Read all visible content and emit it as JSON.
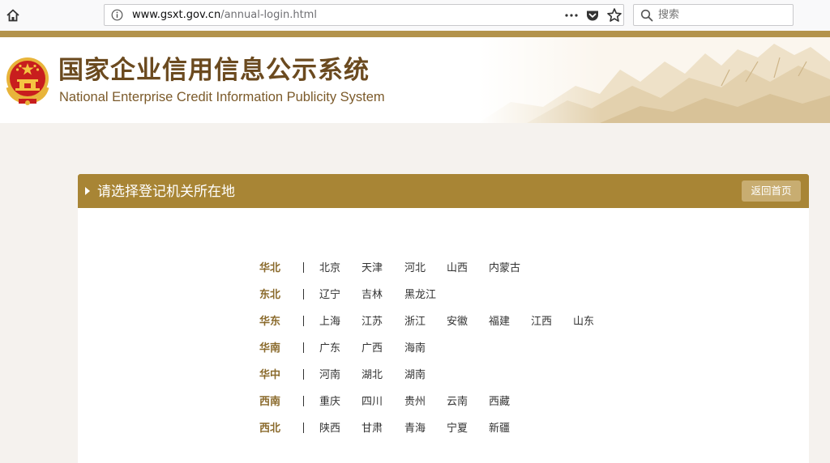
{
  "browser": {
    "url_domain": "www.gsxt.gov.cn",
    "url_path": "/annual-login.html",
    "search_placeholder": "搜索",
    "icons": [
      "home-icon",
      "info-icon",
      "more-icon",
      "pocket-icon",
      "star-icon",
      "search-icon"
    ]
  },
  "header": {
    "title_cn": "国家企业信用信息公示系统",
    "title_en": "National Enterprise Credit Information Publicity System",
    "colors": {
      "gold": "#b3934c",
      "title": "#6b4a1f"
    }
  },
  "panel": {
    "title": "请选择登记机关所在地",
    "home_button": "返回首页",
    "header_color": "#a88535"
  },
  "regions": [
    {
      "name": "华北",
      "provinces": [
        "北京",
        "天津",
        "河北",
        "山西",
        "内蒙古"
      ]
    },
    {
      "name": "东北",
      "provinces": [
        "辽宁",
        "吉林",
        "黑龙江"
      ]
    },
    {
      "name": "华东",
      "provinces": [
        "上海",
        "江苏",
        "浙江",
        "安徽",
        "福建",
        "江西",
        "山东"
      ]
    },
    {
      "name": "华南",
      "provinces": [
        "广东",
        "广西",
        "海南"
      ]
    },
    {
      "name": "华中",
      "provinces": [
        "河南",
        "湖北",
        "湖南"
      ]
    },
    {
      "name": "西南",
      "provinces": [
        "重庆",
        "四川",
        "贵州",
        "云南",
        "西藏"
      ]
    },
    {
      "name": "西北",
      "provinces": [
        "陕西",
        "甘肃",
        "青海",
        "宁夏",
        "新疆"
      ]
    }
  ]
}
